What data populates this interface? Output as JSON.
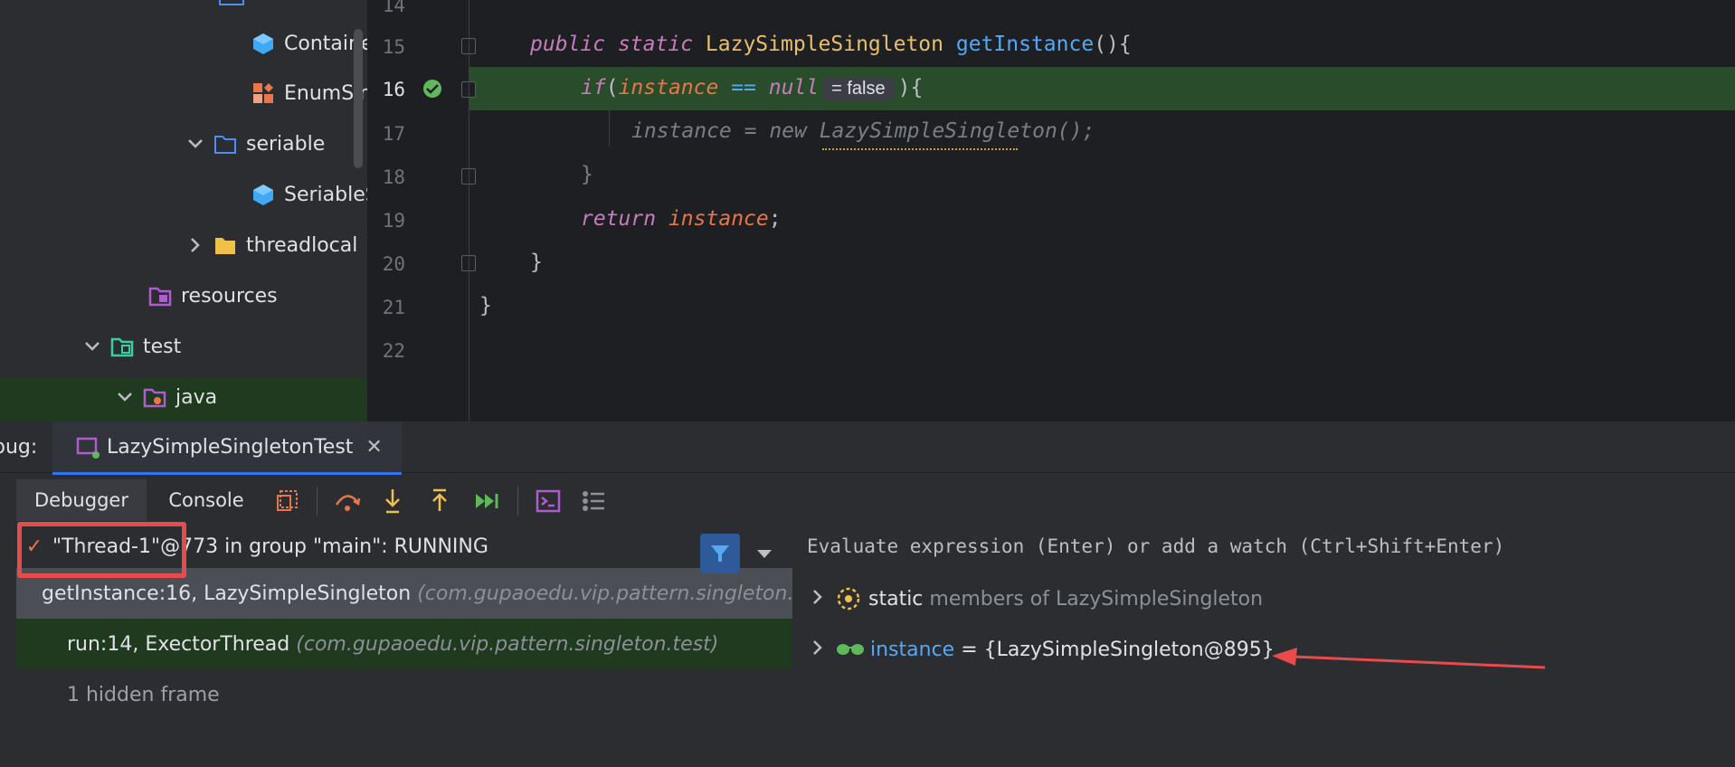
{
  "tree": {
    "items": [
      {
        "label": "Containe",
        "icon": "class-cube-icon"
      },
      {
        "label": "EnumSir",
        "icon": "enum-icon"
      },
      {
        "label": "seriable",
        "icon": "folder-icon"
      },
      {
        "label": "SeriableS",
        "icon": "class-cube-icon"
      },
      {
        "label": "threadlocal",
        "icon": "folder-icon"
      },
      {
        "label": "resources",
        "icon": "resources-folder-icon"
      },
      {
        "label": "test",
        "icon": "test-folder-icon"
      },
      {
        "label": "java",
        "icon": "java-source-folder-icon"
      }
    ]
  },
  "editor": {
    "line_numbers": [
      "14",
      "15",
      "16",
      "17",
      "18",
      "19",
      "20",
      "21",
      "22"
    ],
    "line15": {
      "kw1": "public",
      "kw2": "static",
      "type": "LazySimpleSingleton",
      "method": "getInstance",
      "tail": "(){"
    },
    "line16": {
      "kw": "if",
      "open": "(",
      "field": "instance",
      "op": " == ",
      "null": "null",
      "inlay": "= false",
      "close": "){"
    },
    "line17": {
      "text": "instance = new LazySimpleSingleton();"
    },
    "line18": {
      "text": "}"
    },
    "line19": {
      "kw": "return",
      "field": "instance",
      "semi": ";"
    },
    "line20": {
      "text": "}"
    },
    "line21": {
      "text": "}"
    }
  },
  "debug": {
    "label": "bug:",
    "run_tab": "LazySimpleSingletonTest",
    "sub_tabs": {
      "debugger": "Debugger",
      "console": "Console"
    },
    "thread": "\"Thread-1\"@773 in group \"main\": RUNNING",
    "frames": [
      {
        "method": "getInstance:16, LazySimpleSingleton",
        "pkg": "(com.gupaoedu.vip.pattern.singleton.l"
      },
      {
        "method": "run:14, ExectorThread",
        "pkg": "(com.gupaoedu.vip.pattern.singleton.test)"
      }
    ],
    "hidden": "1 hidden frame",
    "evaluate_placeholder": "Evaluate expression (Enter) or add a watch (Ctrl+Shift+Enter)",
    "vars": [
      {
        "prefix": "static",
        "rest": "members of LazySimpleSingleton"
      },
      {
        "name": "instance",
        "value": "= {LazySimpleSingleton@895}"
      }
    ]
  },
  "colors": {
    "accent": "#3574f0",
    "annotation": "#e84b4b",
    "current_line": "#294d2b"
  }
}
